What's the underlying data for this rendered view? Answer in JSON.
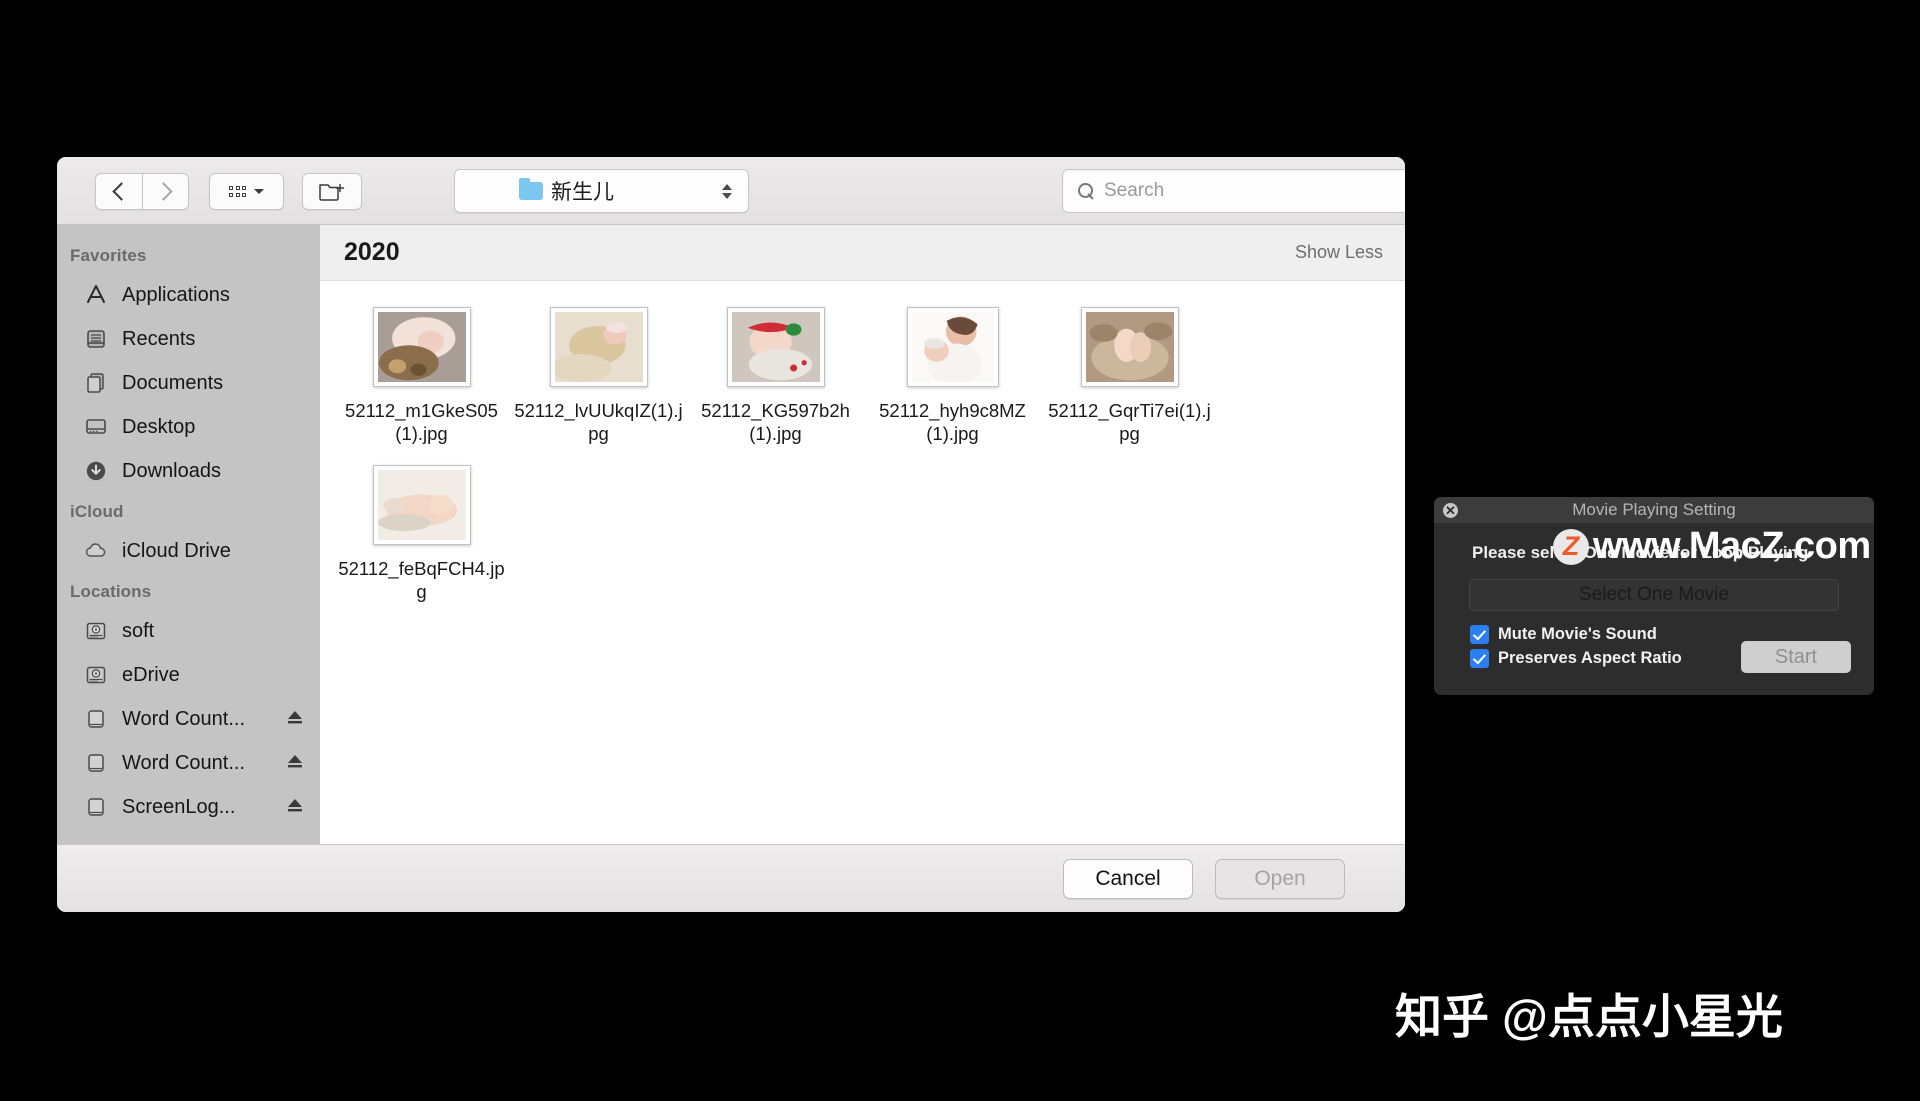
{
  "finder": {
    "toolbar": {
      "back_icon": "chevron-left-icon",
      "forward_icon": "chevron-right-icon",
      "view_mode_icon": "grid-dots-icon",
      "new_folder_icon": "new-folder-icon",
      "path_label": "新生儿",
      "folder_icon": "folder-icon",
      "stepper_icon": "updown-stepper-icon",
      "search_placeholder": "Search",
      "search_value": "",
      "search_icon": "search-icon"
    },
    "sidebar": {
      "sections": [
        {
          "title": "Favorites",
          "items": [
            {
              "label": "Applications",
              "icon": "applications-icon",
              "eject": false
            },
            {
              "label": "Recents",
              "icon": "recents-icon",
              "eject": false
            },
            {
              "label": "Documents",
              "icon": "documents-icon",
              "eject": false
            },
            {
              "label": "Desktop",
              "icon": "desktop-icon",
              "eject": false
            },
            {
              "label": "Downloads",
              "icon": "downloads-icon",
              "eject": false
            }
          ]
        },
        {
          "title": "iCloud",
          "items": [
            {
              "label": "iCloud Drive",
              "icon": "cloud-icon",
              "eject": false
            }
          ]
        },
        {
          "title": "Locations",
          "items": [
            {
              "label": "soft",
              "icon": "harddisk-icon",
              "eject": false
            },
            {
              "label": "eDrive",
              "icon": "harddisk-icon",
              "eject": false
            },
            {
              "label": "Word Count...",
              "icon": "external-drive-icon",
              "eject": true
            },
            {
              "label": "Word Count...",
              "icon": "external-drive-icon",
              "eject": true
            },
            {
              "label": "ScreenLog...",
              "icon": "external-drive-icon",
              "eject": true
            }
          ]
        }
      ]
    },
    "content": {
      "group_title": "2020",
      "show_less_label": "Show Less",
      "files": [
        {
          "name": "52112_m1GkeS05(1).jpg",
          "thumb": "baby-pink-bonnet",
          "orientation": "landscape"
        },
        {
          "name": "52112_lvUUkqIZ(1).jpg",
          "thumb": "baby-cream-wrap",
          "orientation": "landscape"
        },
        {
          "name": "52112_KG597b2h(1).jpg",
          "thumb": "baby-red-headband",
          "orientation": "landscape"
        },
        {
          "name": "52112_hyh9c8MZ(1).jpg",
          "thumb": "mother-and-baby",
          "orientation": "portrait"
        },
        {
          "name": "52112_GqrTi7ei(1).jpg",
          "thumb": "baby-feet",
          "orientation": "landscape"
        },
        {
          "name": "52112_feBqFCH4.jpg",
          "thumb": "baby-sleeping",
          "orientation": "landscape"
        }
      ]
    },
    "footer": {
      "cancel_label": "Cancel",
      "open_label": "Open"
    }
  },
  "movie_dialog": {
    "title": "Movie Playing Setting",
    "close_icon": "close-icon",
    "prompt": "Please select One Movie for Loop Playing",
    "select_button_label": "Select One Movie",
    "checkboxes": [
      {
        "label": "Mute Movie's Sound",
        "checked": true
      },
      {
        "label": "Preserves Aspect Ratio",
        "checked": true
      }
    ],
    "start_label": "Start"
  },
  "watermarks": {
    "macz": "www.MacZ.com",
    "macz_logo_letter": "Z",
    "zhihu": "知乎 @点点小星光"
  },
  "colors": {
    "accent_blue": "#2b7ff5",
    "window_chrome": "#ececec",
    "sidebar": "#c4c4c4",
    "dialog_bg": "#2d2d2d",
    "macz_orange": "#f05a28"
  }
}
